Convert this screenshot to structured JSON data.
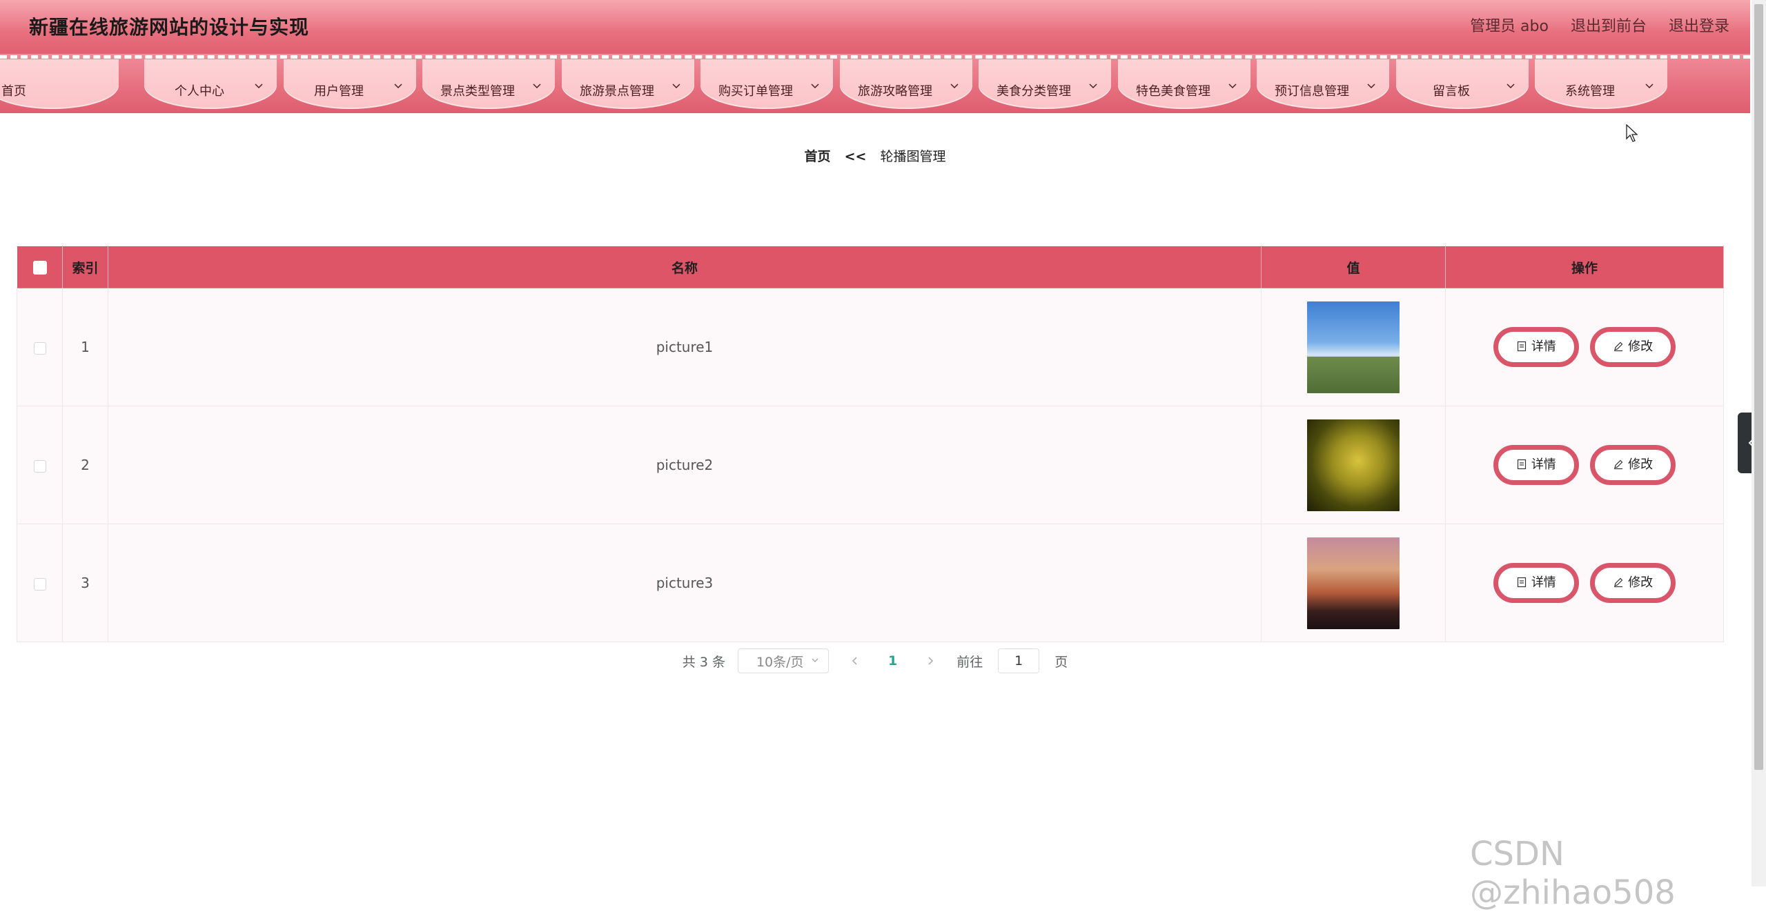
{
  "header": {
    "title": "新疆在线旅游网站的设计与实现",
    "admin_label": "管理员 abo",
    "back_front": "退出到前台",
    "logout": "退出登录"
  },
  "nav": {
    "items": [
      {
        "label": "首页",
        "has_dropdown": false
      },
      {
        "label": "个人中心",
        "has_dropdown": true
      },
      {
        "label": "用户管理",
        "has_dropdown": true
      },
      {
        "label": "景点类型管理",
        "has_dropdown": true
      },
      {
        "label": "旅游景点管理",
        "has_dropdown": true
      },
      {
        "label": "购买订单管理",
        "has_dropdown": true
      },
      {
        "label": "旅游攻略管理",
        "has_dropdown": true
      },
      {
        "label": "美食分类管理",
        "has_dropdown": true
      },
      {
        "label": "特色美食管理",
        "has_dropdown": true
      },
      {
        "label": "预订信息管理",
        "has_dropdown": true
      },
      {
        "label": "留言板",
        "has_dropdown": true
      },
      {
        "label": "系统管理",
        "has_dropdown": true
      }
    ]
  },
  "breadcrumb": {
    "home": "首页",
    "separator": "<<",
    "current": "轮播图管理"
  },
  "table": {
    "headers": {
      "index": "索引",
      "name": "名称",
      "value": "值",
      "actions": "操作"
    },
    "rows": [
      {
        "index": "1",
        "name": "picture1",
        "image": "campus-building"
      },
      {
        "index": "2",
        "name": "picture2",
        "image": "golden-leaves"
      },
      {
        "index": "3",
        "name": "picture3",
        "image": "bridge-sunset"
      }
    ],
    "detail_label": "详情",
    "edit_label": "修改"
  },
  "pagination": {
    "total": "共 3 条",
    "page_size": "10条/页",
    "current_page": "1",
    "goto_prefix": "前往",
    "goto_value": "1",
    "goto_suffix": "页"
  },
  "watermark": "CSDN @zhihao508",
  "colors": {
    "header_top": "#f7a8b0",
    "header_bottom": "#e05f70",
    "table_head": "#de5568",
    "button_border": "#d9566a",
    "page_active": "#2aa58d"
  }
}
